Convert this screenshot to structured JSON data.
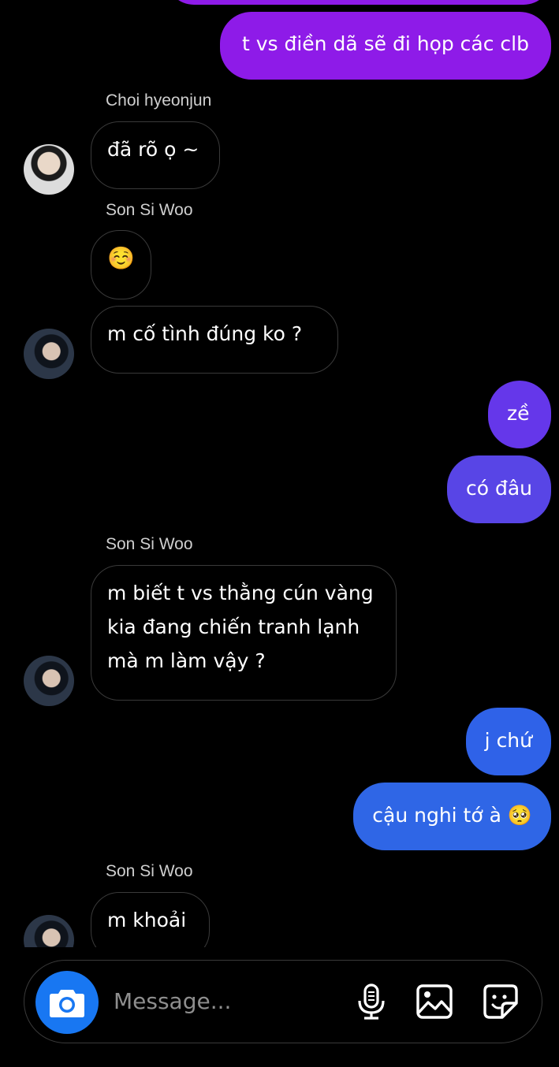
{
  "messages": [
    {
      "type": "out",
      "text": "t vs điền dã sẽ đi họp các clb",
      "color": "#8e1be8"
    },
    {
      "type": "sender",
      "text": "Choi hyeonjun"
    },
    {
      "type": "in",
      "text": "đã rõ ọ ~"
    },
    {
      "type": "sender",
      "text": "Son Si Woo"
    },
    {
      "type": "in",
      "text": "☺️"
    },
    {
      "type": "in",
      "text": "m cố tình đúng ko ?"
    },
    {
      "type": "out",
      "text": "zề",
      "color": "#6537ea"
    },
    {
      "type": "out",
      "text": "có đâu",
      "color": "#5845e6"
    },
    {
      "type": "sender",
      "text": "Son Si Woo"
    },
    {
      "type": "in",
      "text": "m biết t vs thằng cún vàng\nkia đang chiến tranh lạnh\nmà m làm vậy ?"
    },
    {
      "type": "out",
      "text": "j chứ",
      "color": "#2f62e8"
    },
    {
      "type": "out",
      "text": "cậu nghi tớ à 🥺",
      "color": "#2f66e6"
    },
    {
      "type": "sender",
      "text": "Son Si Woo"
    },
    {
      "type": "in",
      "text": "m khoải"
    }
  ],
  "composer": {
    "placeholder": "Message...",
    "icons": [
      "camera-icon",
      "microphone-icon",
      "gallery-icon",
      "sticker-icon"
    ],
    "accent": "#1877f2"
  }
}
